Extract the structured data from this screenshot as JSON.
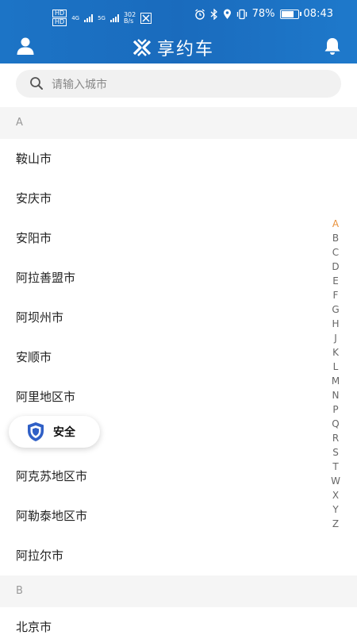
{
  "statusbar": {
    "hd1": "HD",
    "hd2": "HD",
    "net1": "4G",
    "net2": "5G",
    "speed_value": "302",
    "speed_unit": "B/s",
    "battery": "78%",
    "time": "08:43"
  },
  "header": {
    "title": "享约车",
    "logo_icon": "x-logo-icon",
    "left_icon": "user-icon",
    "right_icon": "bell-icon",
    "color": "#1c6fc3"
  },
  "search": {
    "placeholder": "请输入城市",
    "value": ""
  },
  "sections": [
    {
      "letter": "A",
      "cities": [
        "鞍山市",
        "安庆市",
        "安阳市",
        "阿拉善盟市",
        "阿坝州市",
        "安顺市",
        "阿里地区市",
        "",
        "阿克苏地区市",
        "阿勒泰地区市",
        "阿拉尔市"
      ]
    },
    {
      "letter": "B",
      "cities": [
        "北京市"
      ]
    }
  ],
  "index": {
    "letters": [
      "A",
      "B",
      "C",
      "D",
      "E",
      "F",
      "G",
      "H",
      "J",
      "K",
      "L",
      "M",
      "N",
      "P",
      "Q",
      "R",
      "S",
      "T",
      "W",
      "X",
      "Y",
      "Z"
    ],
    "active": "A",
    "active_color": "#e8903a"
  },
  "safety": {
    "label": "安全",
    "icon": "shield-icon",
    "icon_color": "#2f5fc6"
  }
}
